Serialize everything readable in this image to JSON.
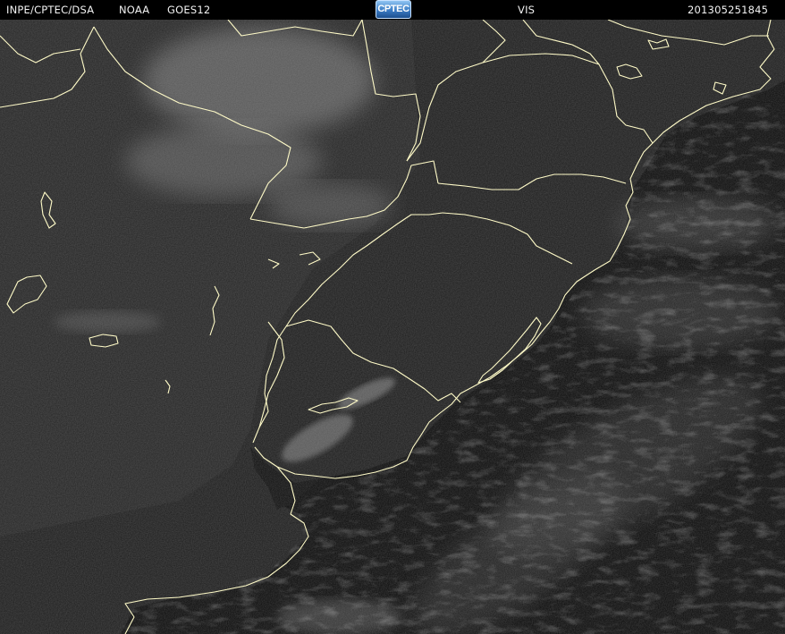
{
  "header": {
    "source": "INPE/CPTEC/DSA",
    "agency": "NOAA",
    "satellite": "GOES12",
    "channel": "VIS",
    "timestamp": "201305251845",
    "logo_text": "CPTEC"
  },
  "imagery": {
    "kind": "satellite-visible-image",
    "region": "southern-south-america",
    "colors": {
      "background": "#000000",
      "land": "#262626",
      "ocean_land": "#141414",
      "boundaries": "#fffbc8",
      "logo_blue": "#3b7cc4"
    }
  }
}
